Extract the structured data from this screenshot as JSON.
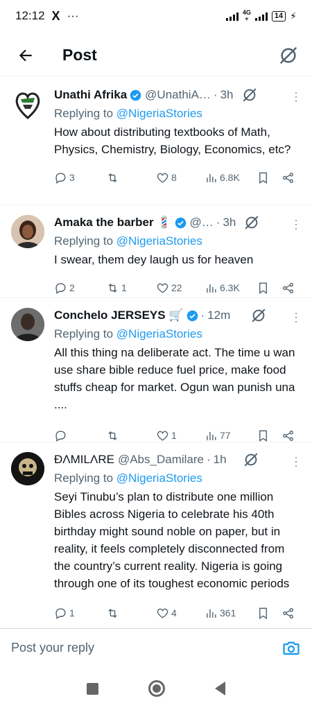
{
  "status_bar": {
    "time": "12:12",
    "x_icon": "X",
    "more_icon": "···",
    "network": "4G",
    "network_sub": "+",
    "battery": "14"
  },
  "header": {
    "title": "Post"
  },
  "replies": [
    {
      "name": "Unathi Afrika",
      "handle": "@UnathiA…",
      "time": "3h",
      "replying_prefix": "Replying to",
      "replying_to": "@NigeriaStories",
      "text": "How about distributing textbooks of Math, Physics, Chemistry, Biology, Economics, etc?",
      "reply_count": "3",
      "retweet_count": "",
      "like_count": "8",
      "views": "6.8K",
      "verified": true
    },
    {
      "name": "Amaka the barber 💈",
      "handle": "@…",
      "time": "3h",
      "replying_prefix": "Replying to",
      "replying_to": "@NigeriaStories",
      "text": "I swear, them dey laugh us for heaven",
      "reply_count": "2",
      "retweet_count": "1",
      "like_count": "22",
      "views": "6.3K",
      "verified": true
    },
    {
      "name": "Conchelo JERSEYS 🛒",
      "handle": "",
      "time": "12m",
      "replying_prefix": "Replying to",
      "replying_to": "@NigeriaStories",
      "text": "All this thing na deliberate act. The time u wan use share bible reduce fuel price, make food stuffs cheap for market. Ogun wan punish una ....",
      "reply_count": "",
      "retweet_count": "",
      "like_count": "1",
      "views": "77",
      "verified": true
    },
    {
      "name": "ĐΛMILΛRE",
      "handle": "@Abs_Damilare",
      "time": "1h",
      "replying_prefix": "Replying to",
      "replying_to": "@NigeriaStories",
      "text": "Seyi Tinubu’s plan to distribute one million Bibles across Nigeria to celebrate his 40th birthday might sound noble on paper, but in reality, it feels completely disconnected from the country’s current reality. Nigeria is going through one of its toughest economic periods",
      "reply_count": "1",
      "retweet_count": "",
      "like_count": "4",
      "views": "361",
      "verified": false
    }
  ],
  "composer": {
    "placeholder": "Post your reply"
  },
  "colors": {
    "accent": "#1d9bf0",
    "muted": "#536471",
    "text": "#0f1419"
  },
  "icons": [
    "back-arrow-icon",
    "grok-icon",
    "verified-badge-icon",
    "reply-icon",
    "retweet-icon",
    "like-icon",
    "views-icon",
    "bookmark-icon",
    "share-icon",
    "camera-icon"
  ]
}
